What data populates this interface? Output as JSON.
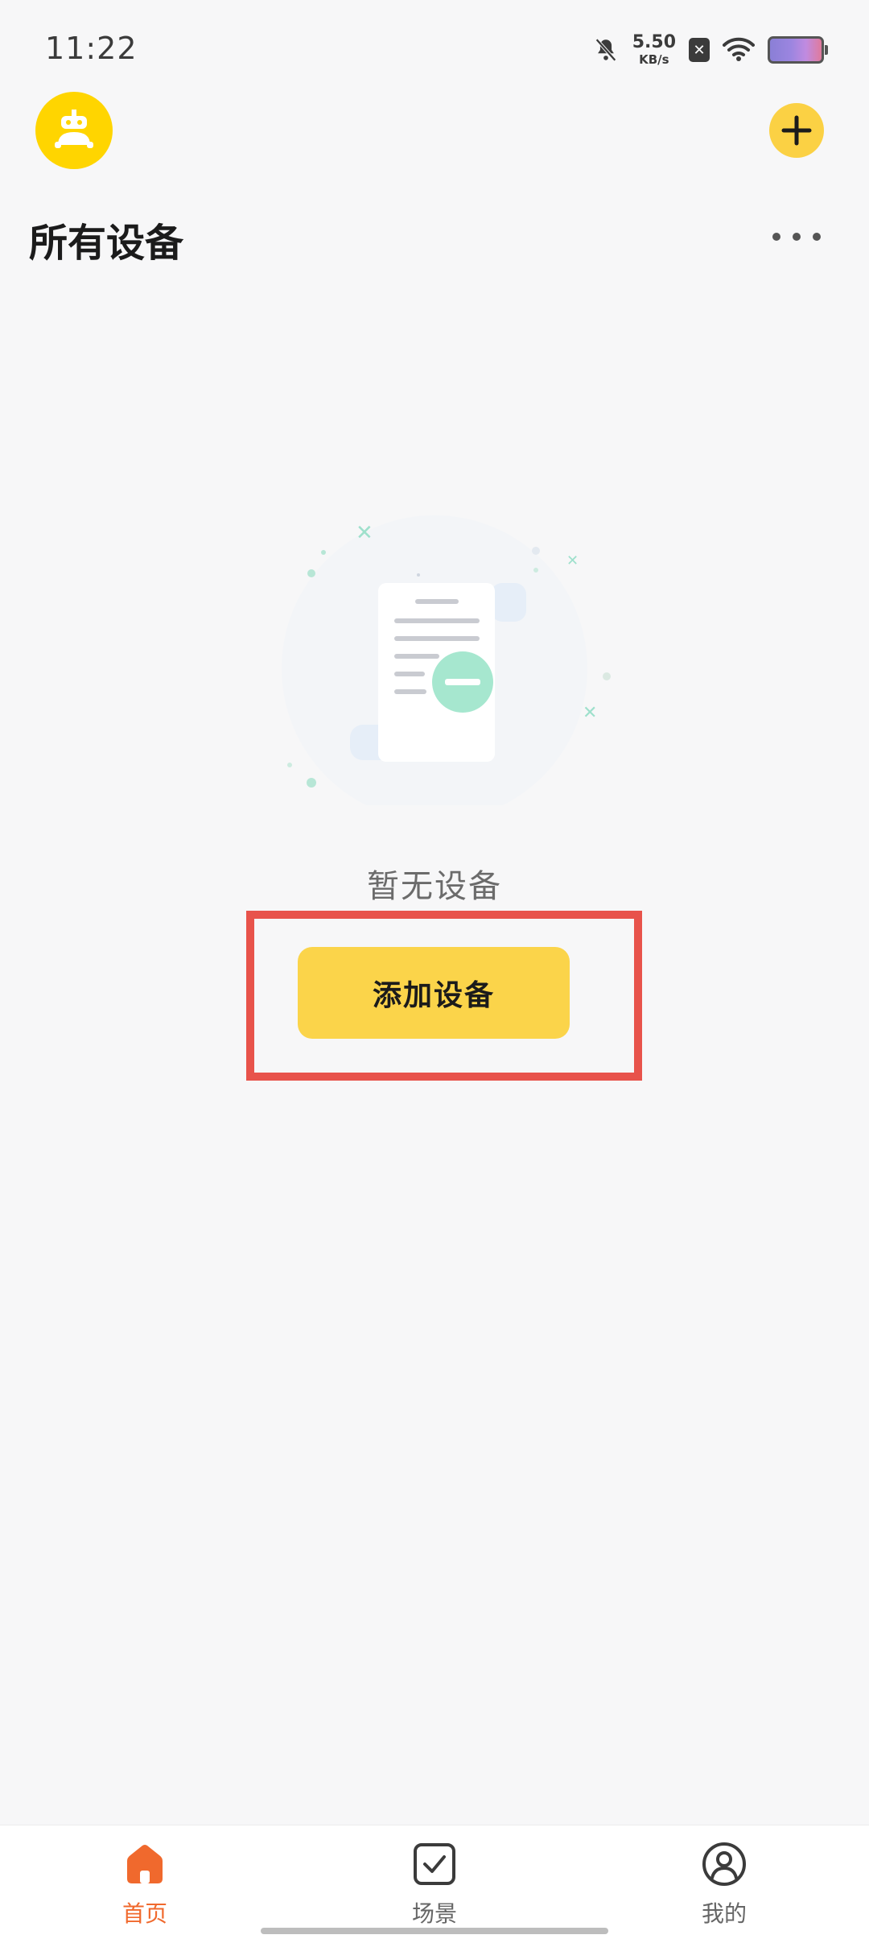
{
  "status_bar": {
    "time": "11:22",
    "net_speed_value": "5.50",
    "net_speed_unit": "KB/s",
    "icons": [
      "mute-bell-icon",
      "sim-error-icon",
      "wifi-icon",
      "battery-icon"
    ]
  },
  "header": {
    "title": "所有设备"
  },
  "empty_state": {
    "message": "暂无设备",
    "add_button_label": "添加设备"
  },
  "bottom_nav": {
    "items": [
      {
        "label": "首页",
        "icon": "home-icon",
        "active": true
      },
      {
        "label": "场景",
        "icon": "checkbox-icon",
        "active": false
      },
      {
        "label": "我的",
        "icon": "user-icon",
        "active": false
      }
    ]
  },
  "colors": {
    "accent_yellow": "#fbd44a",
    "active_orange": "#f0692d",
    "highlight_red": "#e8534b",
    "background": "#f7f7f8"
  }
}
